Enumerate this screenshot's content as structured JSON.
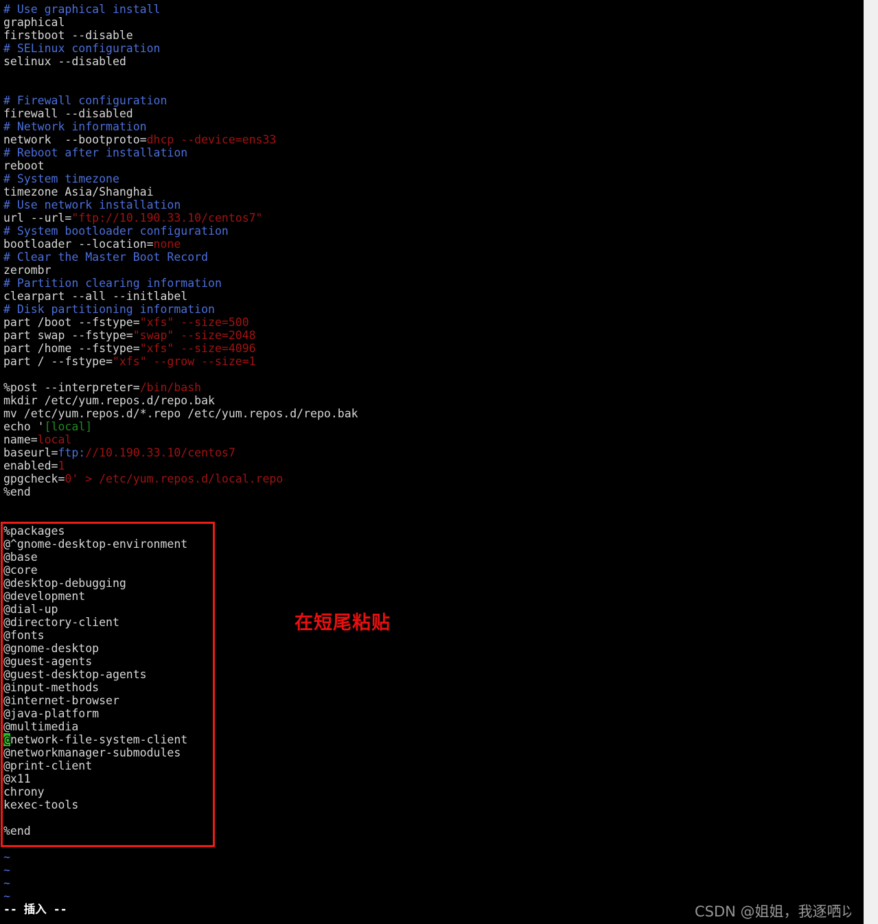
{
  "editor": {
    "name": "vim",
    "mode_status": "-- 插入 --",
    "background": "#000000",
    "foreground": "#d8d8d8",
    "comment_color": "#4b6fdc",
    "value_color": "#a21212",
    "string_color": "#a21212",
    "green_color": "#1f8c1f",
    "cursor_color": "#28c028",
    "filler_char": "~"
  },
  "annotation": {
    "note_text": "在短尾粘贴",
    "note_color": "#e81010",
    "box_color": "#ee1c15"
  },
  "watermark": {
    "text": "CSDN @姐姐，我逐哂以"
  },
  "cursor": {
    "line_index": 59,
    "column_index": 0,
    "char": "@"
  },
  "lines": [
    {
      "i": 0,
      "segments": [
        {
          "t": "# Use graphical install",
          "c": "comment"
        }
      ]
    },
    {
      "i": 1,
      "segments": [
        {
          "t": "graphical",
          "c": "plain"
        }
      ]
    },
    {
      "i": 2,
      "segments": [
        {
          "t": "firstboot --disable",
          "c": "plain"
        }
      ]
    },
    {
      "i": 3,
      "segments": [
        {
          "t": "# SELinux configuration",
          "c": "comment"
        }
      ]
    },
    {
      "i": 4,
      "segments": [
        {
          "t": "selinux --disabled",
          "c": "plain"
        }
      ]
    },
    {
      "i": 5,
      "segments": [
        {
          "t": "",
          "c": "plain"
        }
      ]
    },
    {
      "i": 6,
      "segments": [
        {
          "t": "",
          "c": "plain"
        }
      ]
    },
    {
      "i": 7,
      "segments": [
        {
          "t": "# Firewall configuration",
          "c": "comment"
        }
      ]
    },
    {
      "i": 8,
      "segments": [
        {
          "t": "firewall --disabled",
          "c": "plain"
        }
      ]
    },
    {
      "i": 9,
      "segments": [
        {
          "t": "# Network information",
          "c": "comment"
        }
      ]
    },
    {
      "i": 10,
      "segments": [
        {
          "t": "network  --bootproto=",
          "c": "plain"
        },
        {
          "t": "dhcp --device=ens33",
          "c": "value"
        }
      ]
    },
    {
      "i": 11,
      "segments": [
        {
          "t": "# Reboot after installation",
          "c": "comment"
        }
      ]
    },
    {
      "i": 12,
      "segments": [
        {
          "t": "reboot",
          "c": "plain"
        }
      ]
    },
    {
      "i": 13,
      "segments": [
        {
          "t": "# System timezone",
          "c": "comment"
        }
      ]
    },
    {
      "i": 14,
      "segments": [
        {
          "t": "timezone Asia/Shanghai",
          "c": "plain"
        }
      ]
    },
    {
      "i": 15,
      "segments": [
        {
          "t": "# Use network installation",
          "c": "comment"
        }
      ]
    },
    {
      "i": 16,
      "segments": [
        {
          "t": "url --url=",
          "c": "plain"
        },
        {
          "t": "\"ftp://10.190.33.10/centos7\"",
          "c": "string"
        }
      ]
    },
    {
      "i": 17,
      "segments": [
        {
          "t": "# System bootloader configuration",
          "c": "comment"
        }
      ]
    },
    {
      "i": 18,
      "segments": [
        {
          "t": "bootloader --location=",
          "c": "plain"
        },
        {
          "t": "none",
          "c": "value"
        }
      ]
    },
    {
      "i": 19,
      "segments": [
        {
          "t": "# Clear the Master Boot Record",
          "c": "comment"
        }
      ]
    },
    {
      "i": 20,
      "segments": [
        {
          "t": "zerombr",
          "c": "plain"
        }
      ]
    },
    {
      "i": 21,
      "segments": [
        {
          "t": "# Partition clearing information",
          "c": "comment"
        }
      ]
    },
    {
      "i": 22,
      "segments": [
        {
          "t": "clearpart --all --initlabel",
          "c": "plain"
        }
      ]
    },
    {
      "i": 23,
      "segments": [
        {
          "t": "# Disk partitioning information",
          "c": "comment"
        }
      ]
    },
    {
      "i": 24,
      "segments": [
        {
          "t": "part /boot --fstype=",
          "c": "plain"
        },
        {
          "t": "\"xfs\" --size=500",
          "c": "value"
        }
      ]
    },
    {
      "i": 25,
      "segments": [
        {
          "t": "part swap --fstype=",
          "c": "plain"
        },
        {
          "t": "\"swap\" --size=2048",
          "c": "value"
        }
      ]
    },
    {
      "i": 26,
      "segments": [
        {
          "t": "part /home --fstype=",
          "c": "plain"
        },
        {
          "t": "\"xfs\" --size=4096",
          "c": "value"
        }
      ]
    },
    {
      "i": 27,
      "segments": [
        {
          "t": "part / --fstype=",
          "c": "plain"
        },
        {
          "t": "\"xfs\" --grow --size=1",
          "c": "value"
        }
      ]
    },
    {
      "i": 28,
      "segments": [
        {
          "t": "",
          "c": "plain"
        }
      ]
    },
    {
      "i": 29,
      "segments": [
        {
          "t": "%post --interpreter=",
          "c": "plain"
        },
        {
          "t": "/bin/bash",
          "c": "value"
        }
      ]
    },
    {
      "i": 30,
      "segments": [
        {
          "t": "mkdir /etc/yum.repos.d/repo.bak",
          "c": "plain"
        }
      ]
    },
    {
      "i": 31,
      "segments": [
        {
          "t": "mv /etc/yum.repos.d/*.repo /etc/yum.repos.d/repo.bak",
          "c": "plain"
        }
      ]
    },
    {
      "i": 32,
      "segments": [
        {
          "t": "echo '",
          "c": "plain"
        },
        {
          "t": "[local]",
          "c": "green"
        }
      ]
    },
    {
      "i": 33,
      "segments": [
        {
          "t": "name=",
          "c": "plain"
        },
        {
          "t": "local",
          "c": "value"
        }
      ]
    },
    {
      "i": 34,
      "segments": [
        {
          "t": "baseurl=",
          "c": "plain"
        },
        {
          "t": "ftp:",
          "c": "blue"
        },
        {
          "t": "//10.190.33.10/centos7",
          "c": "value"
        }
      ]
    },
    {
      "i": 35,
      "segments": [
        {
          "t": "enabled=",
          "c": "plain"
        },
        {
          "t": "1",
          "c": "value"
        }
      ]
    },
    {
      "i": 36,
      "segments": [
        {
          "t": "gpgcheck=",
          "c": "plain"
        },
        {
          "t": "0",
          "c": "value"
        },
        {
          "t": "' > /etc/yum.repos.d/local.repo",
          "c": "value"
        }
      ]
    },
    {
      "i": 37,
      "segments": [
        {
          "t": "%end",
          "c": "plain"
        }
      ]
    },
    {
      "i": 38,
      "segments": [
        {
          "t": "",
          "c": "plain"
        }
      ]
    },
    {
      "i": 39,
      "segments": [
        {
          "t": "",
          "c": "plain"
        }
      ]
    },
    {
      "i": 40,
      "segments": [
        {
          "t": "%packages",
          "c": "plain"
        }
      ]
    },
    {
      "i": 41,
      "segments": [
        {
          "t": "@^gnome-desktop-environment",
          "c": "plain"
        }
      ]
    },
    {
      "i": 42,
      "segments": [
        {
          "t": "@base",
          "c": "plain"
        }
      ]
    },
    {
      "i": 43,
      "segments": [
        {
          "t": "@core",
          "c": "plain"
        }
      ]
    },
    {
      "i": 44,
      "segments": [
        {
          "t": "@desktop-debugging",
          "c": "plain"
        }
      ]
    },
    {
      "i": 45,
      "segments": [
        {
          "t": "@development",
          "c": "plain"
        }
      ]
    },
    {
      "i": 46,
      "segments": [
        {
          "t": "@dial-up",
          "c": "plain"
        }
      ]
    },
    {
      "i": 47,
      "segments": [
        {
          "t": "@directory-client",
          "c": "plain"
        }
      ]
    },
    {
      "i": 48,
      "segments": [
        {
          "t": "@fonts",
          "c": "plain"
        }
      ]
    },
    {
      "i": 49,
      "segments": [
        {
          "t": "@gnome-desktop",
          "c": "plain"
        }
      ]
    },
    {
      "i": 50,
      "segments": [
        {
          "t": "@guest-agents",
          "c": "plain"
        }
      ]
    },
    {
      "i": 51,
      "segments": [
        {
          "t": "@guest-desktop-agents",
          "c": "plain"
        }
      ]
    },
    {
      "i": 52,
      "segments": [
        {
          "t": "@input-methods",
          "c": "plain"
        }
      ]
    },
    {
      "i": 53,
      "segments": [
        {
          "t": "@internet-browser",
          "c": "plain"
        }
      ]
    },
    {
      "i": 54,
      "segments": [
        {
          "t": "@java-platform",
          "c": "plain"
        }
      ]
    },
    {
      "i": 55,
      "segments": [
        {
          "t": "@multimedia",
          "c": "plain"
        }
      ]
    },
    {
      "i": 56,
      "segments": [
        {
          "t": "@",
          "c": "cursor"
        },
        {
          "t": "network-file-system-client",
          "c": "plain"
        }
      ]
    },
    {
      "i": 57,
      "segments": [
        {
          "t": "@networkmanager-submodules",
          "c": "plain"
        }
      ]
    },
    {
      "i": 58,
      "segments": [
        {
          "t": "@print-client",
          "c": "plain"
        }
      ]
    },
    {
      "i": 59,
      "segments": [
        {
          "t": "@x11",
          "c": "plain"
        }
      ]
    },
    {
      "i": 60,
      "segments": [
        {
          "t": "chrony",
          "c": "plain"
        }
      ]
    },
    {
      "i": 61,
      "segments": [
        {
          "t": "kexec-tools",
          "c": "plain"
        }
      ]
    },
    {
      "i": 62,
      "segments": [
        {
          "t": "",
          "c": "plain"
        }
      ]
    },
    {
      "i": 63,
      "segments": [
        {
          "t": "%end",
          "c": "plain"
        }
      ]
    },
    {
      "i": 64,
      "segments": [
        {
          "t": "",
          "c": "plain"
        }
      ]
    },
    {
      "i": 65,
      "segments": [
        {
          "t": "~",
          "c": "tilde"
        }
      ]
    },
    {
      "i": 66,
      "segments": [
        {
          "t": "~",
          "c": "tilde"
        }
      ]
    },
    {
      "i": 67,
      "segments": [
        {
          "t": "~",
          "c": "tilde"
        }
      ]
    },
    {
      "i": 68,
      "segments": [
        {
          "t": "~",
          "c": "tilde"
        }
      ]
    }
  ]
}
